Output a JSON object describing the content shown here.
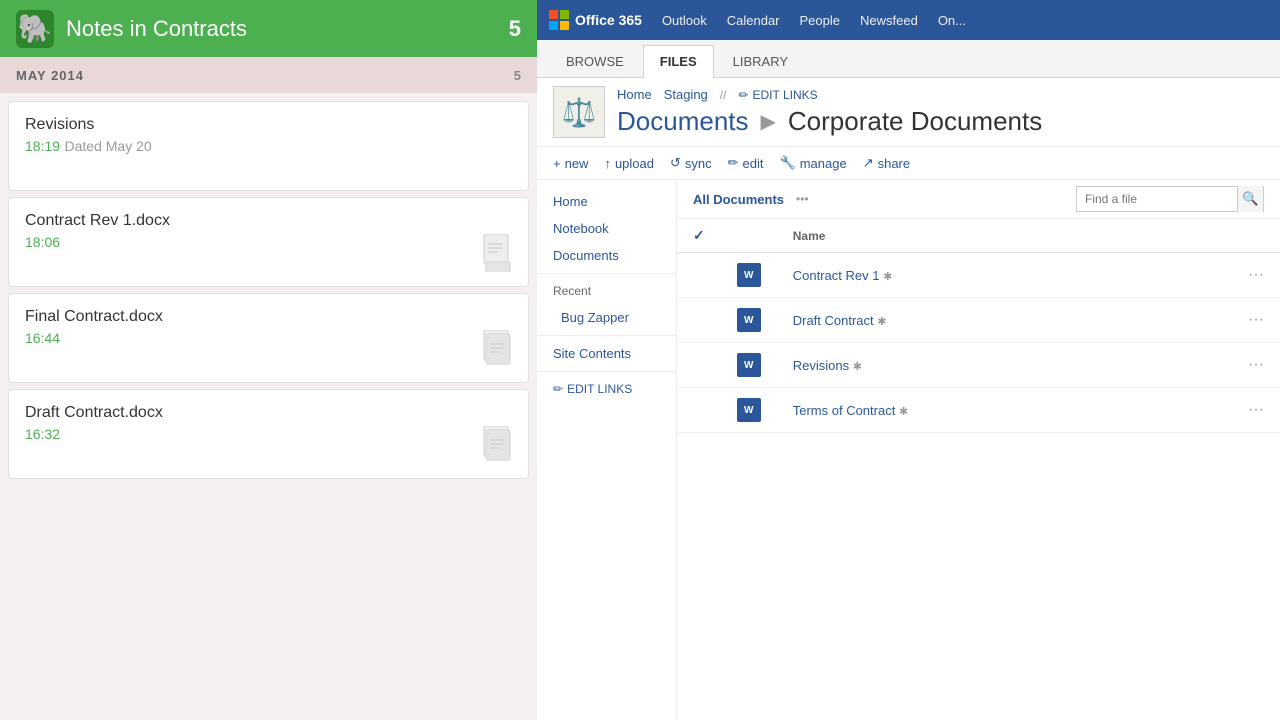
{
  "left_panel": {
    "app_title": "Notes in Contracts",
    "note_count": "5",
    "month_label": "MAY 2014",
    "month_count": "5",
    "notes": [
      {
        "title": "Revisions",
        "time": "18:19",
        "extra": "Dated May 20",
        "has_icon": false
      },
      {
        "title": "Contract Rev 1.docx",
        "time": "18:06",
        "extra": "",
        "has_icon": true
      },
      {
        "title": "Final Contract.docx",
        "time": "16:44",
        "extra": "",
        "has_icon": true
      },
      {
        "title": "Draft Contract.docx",
        "time": "16:32",
        "extra": "",
        "has_icon": true
      }
    ]
  },
  "right_panel": {
    "o365_logo": "Office 365",
    "nav_links": [
      "Outlook",
      "Calendar",
      "People",
      "Newsfeed",
      "On..."
    ],
    "tabs": [
      "BROWSE",
      "FILES",
      "LIBRARY"
    ],
    "active_tab": "FILES",
    "site_logo_symbol": "⚖",
    "nav": {
      "home": "Home",
      "staging": "Staging",
      "edit_links": "EDIT LINKS"
    },
    "breadcrumb": {
      "documents": "Documents",
      "arrow": "▶",
      "corporate": "Corporate Documents"
    },
    "actions": {
      "new": "+ new",
      "upload": "upload",
      "sync": "sync",
      "edit": "edit",
      "manage": "manage",
      "share": "share"
    },
    "sidebar": {
      "home": "Home",
      "notebook": "Notebook",
      "documents": "Documents",
      "recent": "Recent",
      "bug_zapper": "Bug Zapper",
      "site_contents": "Site Contents",
      "edit_links": "EDIT LINKS"
    },
    "files_toolbar": {
      "all_documents": "All Documents",
      "more": "...",
      "search_placeholder": "Find a file"
    },
    "table": {
      "col_name": "Name",
      "files": [
        {
          "name": "Contract Rev 1",
          "checked": false
        },
        {
          "name": "Draft Contract",
          "checked": false
        },
        {
          "name": "Revisions",
          "checked": false
        },
        {
          "name": "Terms of Contract",
          "checked": false
        }
      ]
    }
  }
}
